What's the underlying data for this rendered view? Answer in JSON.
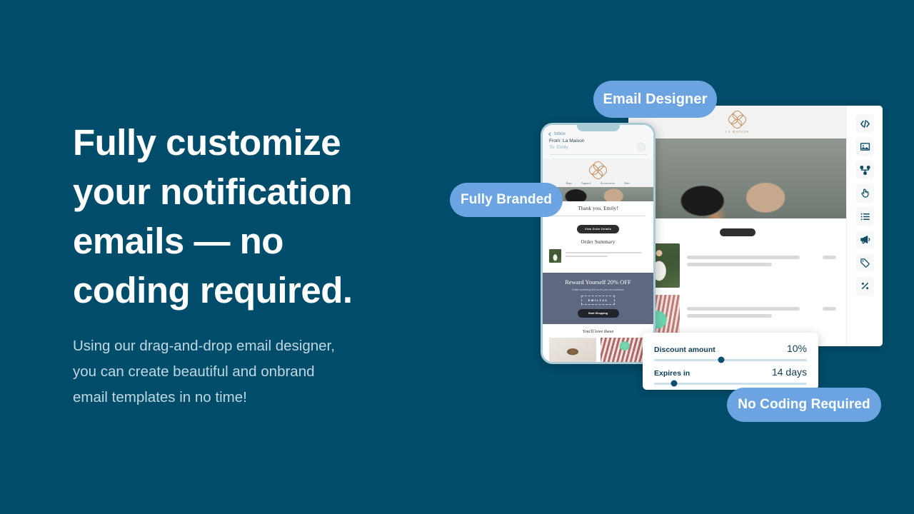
{
  "theme": {
    "background": "#004D6B",
    "pill_blue": "#6BA4E0",
    "heading_color": "#FFFFFF",
    "subcopy_color": "#BFD8E2",
    "accent_dark": "#0F4C63"
  },
  "copy": {
    "headline": "Fully customize\nyour notification\nemails — no\ncoding required.",
    "subcopy": "Using our drag-and-drop email designer,\nyou can create beautiful and onbrand\nemail templates in no time!"
  },
  "pills": [
    {
      "id": "email-designer",
      "label": "Email Designer"
    },
    {
      "id": "fully-branded",
      "label": "Fully Branded"
    },
    {
      "id": "no-coding",
      "label": "No Coding Required"
    }
  ],
  "designer": {
    "brand_name": "LA MAISON",
    "toolbar": [
      {
        "icon": "code-icon",
        "label": "Code block"
      },
      {
        "icon": "image-icon",
        "label": "Image block"
      },
      {
        "icon": "share-node-icon",
        "label": "Social links"
      },
      {
        "icon": "hand-pointer-icon",
        "label": "Button block"
      },
      {
        "icon": "list-icon",
        "label": "List block"
      },
      {
        "icon": "megaphone-icon",
        "label": "Announcement block"
      },
      {
        "icon": "tag-icon",
        "label": "Product tag block"
      },
      {
        "icon": "percent-icon",
        "label": "Discount block"
      }
    ],
    "products": [
      {
        "name": "product-row-1"
      },
      {
        "name": "product-row-2"
      }
    ]
  },
  "phone": {
    "inbox_label": "Inbox",
    "from": "From: La Maison",
    "to": "To: Emily",
    "brand_name": "LA MAISON",
    "nav": [
      "Bags",
      "Apparel",
      "Accessories",
      "Hats"
    ],
    "thanks": "Thank you, Emily!",
    "order_button": "View Order Details",
    "order_summary": "Order Summary",
    "promo_heading": "Reward Yourself 20% OFF",
    "promo_sub": "A little something from us for your next purchase",
    "promo_code": "EMILY20",
    "promo_button": "Start Shopping",
    "recommend_heading": "You'll love these"
  },
  "discount_panel": {
    "rows": [
      {
        "label": "Discount amount",
        "value": "10%",
        "knob_percent": 44
      },
      {
        "label": "Expires in",
        "value": "14 days",
        "knob_percent": 13
      }
    ]
  }
}
